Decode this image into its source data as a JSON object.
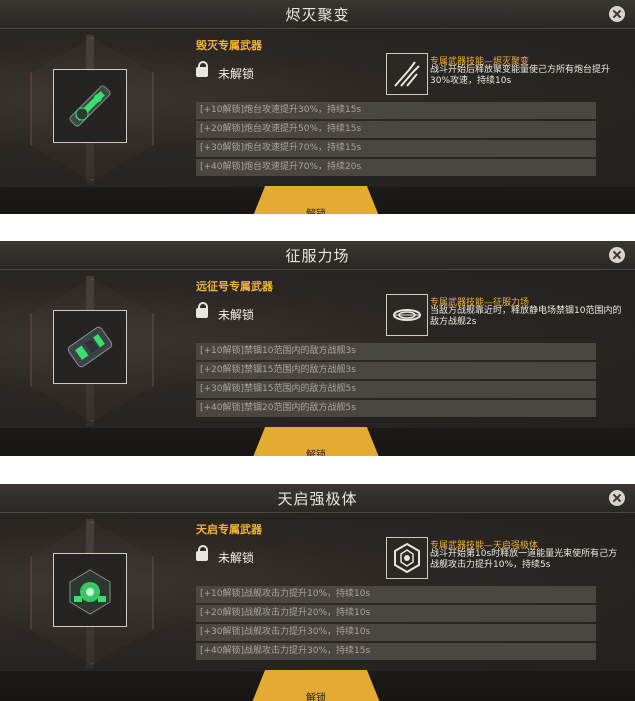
{
  "panels": [
    {
      "title": "烬灭聚变",
      "weapon_label": "毁灭专属武器",
      "lock_text": "未解锁",
      "skill_title": "专属武器技能—烬灭聚变",
      "skill_desc": "战斗开始后释放聚变能量使己方所有炮台提升30%攻速，持续10s",
      "rows": [
        "[+10解锁]炮台攻速提升30%，持续15s",
        "[+20解锁]炮台攻速提升50%，持续15s",
        "[+30解锁]炮台攻速提升70%，持续15s",
        "[+40解锁]炮台攻速提升70%，持续20s"
      ],
      "button": "解锁",
      "skill_icon": "claw-icon",
      "weapon_icon": "cannon-weapon-icon"
    },
    {
      "title": "征服力场",
      "weapon_label": "远征号专属武器",
      "lock_text": "未解锁",
      "skill_title": "专属武器技能—征服力场",
      "skill_desc": "当敌方战舰靠近时，释放静电场禁锢10范围内的敌方战舰2s",
      "rows": [
        "[+10解锁]禁锢10范围内的敌方战舰3s",
        "[+20解锁]禁锢15范围内的敌方战舰3s",
        "[+30解锁]禁锢15范围内的敌方战舰5s",
        "[+40解锁]禁锢20范围内的敌方战舰5s"
      ],
      "button": "解锁",
      "skill_icon": "vortex-icon",
      "weapon_icon": "field-generator-icon"
    },
    {
      "title": "天启强极体",
      "weapon_label": "天启专属武器",
      "lock_text": "未解锁",
      "skill_title": "专属武器技能—天启强极体",
      "skill_desc": "战斗开始第10s时释放一道能量光束使所有己方战舰攻击力提升10%，持续5s",
      "rows": [
        "[+10解锁]战舰攻击力提升10%，持续10s",
        "[+20解锁]战舰攻击力提升20%，持续10s",
        "[+30解锁]战舰攻击力提升30%，持续10s",
        "[+40解锁]战舰攻击力提升30%，持续15s"
      ],
      "button": "解锁",
      "skill_icon": "hexagon-core-icon",
      "weapon_icon": "reactor-core-icon"
    }
  ],
  "colors": {
    "accent": "#f0b33a",
    "button": "#e3ab31",
    "glow": "#39e06b"
  }
}
